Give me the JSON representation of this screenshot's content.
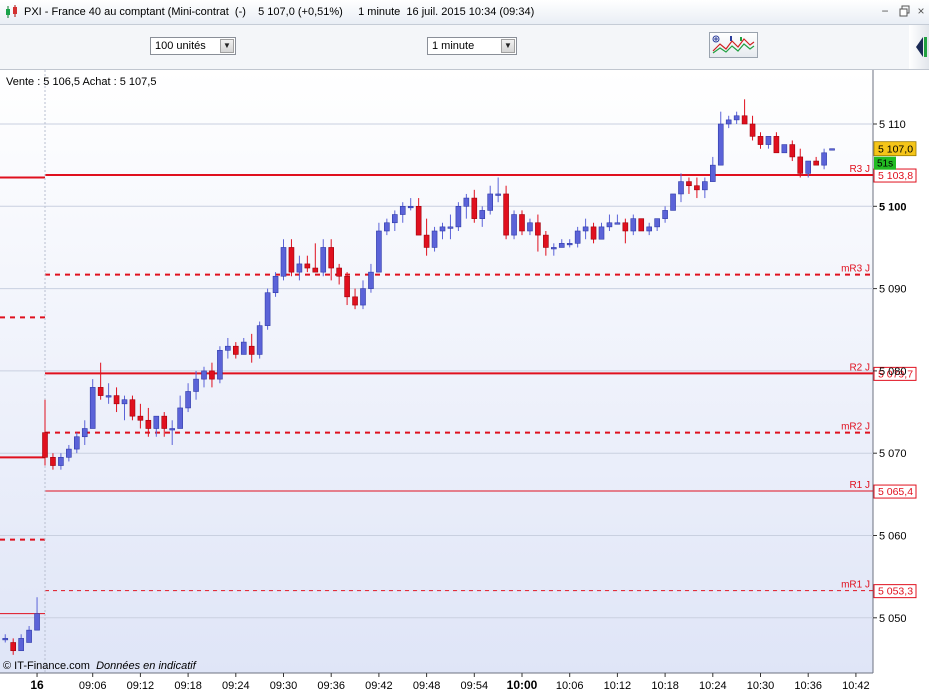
{
  "window": {
    "title": "PXI - France 40 au comptant (Mini-contrat  (-)    5 107,0 (+0,51%)     1 minute  16 juil. 2015 10:34 (09:34)",
    "minimize": "−",
    "close": "×"
  },
  "toolbar": {
    "quantity": "100 unités",
    "timeframe": "1 minute"
  },
  "quote": {
    "line": "Vente : 5 106,5 Achat : 5 107,5"
  },
  "footer": {
    "source": "© IT-Finance.com",
    "note": "Données en indicatif"
  },
  "colors": {
    "up": "#5b63d8",
    "down": "#e0101e",
    "pivot": "#e0101e",
    "price_badge": "#f5c518",
    "timer_badge": "#22bb22"
  },
  "chart_data": {
    "type": "candlestick",
    "ylim": [
      5041,
      5122
    ],
    "yticks": [
      {
        "v": 5050,
        "label": "5 050"
      },
      {
        "v": 5060,
        "label": "5 060"
      },
      {
        "v": 5070,
        "label": "5 070"
      },
      {
        "v": 5080,
        "label": "5 080"
      },
      {
        "v": 5090,
        "label": "5 090"
      },
      {
        "v": 5100,
        "label": "5 100"
      },
      {
        "v": 5110,
        "label": "5 110"
      }
    ],
    "xticks": [
      {
        "t": -1,
        "label": "16"
      },
      {
        "t": 6,
        "label": "09:06"
      },
      {
        "t": 12,
        "label": "09:12"
      },
      {
        "t": 18,
        "label": "09:18"
      },
      {
        "t": 24,
        "label": "09:24"
      },
      {
        "t": 30,
        "label": "09:30"
      },
      {
        "t": 36,
        "label": "09:36"
      },
      {
        "t": 42,
        "label": "09:42"
      },
      {
        "t": 48,
        "label": "09:48"
      },
      {
        "t": 54,
        "label": "09:54"
      },
      {
        "t": 60,
        "label": "10:00"
      },
      {
        "t": 66,
        "label": "10:06"
      },
      {
        "t": 72,
        "label": "10:12"
      },
      {
        "t": 78,
        "label": "10:18"
      },
      {
        "t": 84,
        "label": "10:24"
      },
      {
        "t": 90,
        "label": "10:30"
      },
      {
        "t": 96,
        "label": "10:36"
      },
      {
        "t": 102,
        "label": "10:42"
      }
    ],
    "prev_session_ohlc": [
      [
        5047.5,
        5048,
        5047,
        5047.5
      ],
      [
        5047,
        5047.5,
        5045.5,
        5046
      ],
      [
        5046,
        5048,
        5046,
        5047.5
      ],
      [
        5047,
        5049,
        5047,
        5048.5
      ],
      [
        5048.5,
        5052.5,
        5048.5,
        5050.5
      ]
    ],
    "ohlc": [
      [
        5072.5,
        5076.5,
        5068.5,
        5069.5
      ],
      [
        5069.5,
        5070,
        5068,
        5068.5
      ],
      [
        5068.5,
        5070,
        5068,
        5069.5
      ],
      [
        5069.5,
        5071,
        5069,
        5070.5
      ],
      [
        5070.5,
        5072.5,
        5070,
        5072
      ],
      [
        5072,
        5074,
        5071,
        5073
      ],
      [
        5073,
        5079,
        5073,
        5078
      ],
      [
        5078,
        5081,
        5076.5,
        5077
      ],
      [
        5077,
        5078.5,
        5076,
        5077
      ],
      [
        5077,
        5078,
        5075,
        5076
      ],
      [
        5076,
        5077,
        5074,
        5076.5
      ],
      [
        5076.5,
        5077,
        5074,
        5074.5
      ],
      [
        5074.5,
        5076,
        5073,
        5074
      ],
      [
        5074,
        5075.5,
        5072,
        5073
      ],
      [
        5073,
        5074.5,
        5072,
        5074.5
      ],
      [
        5074.5,
        5075,
        5072,
        5073
      ],
      [
        5073,
        5074,
        5071,
        5073
      ],
      [
        5073,
        5077,
        5073,
        5075.5
      ],
      [
        5075.5,
        5078.5,
        5075,
        5077.5
      ],
      [
        5077.5,
        5080,
        5076.5,
        5079
      ],
      [
        5079,
        5080.5,
        5078,
        5080
      ],
      [
        5080,
        5081,
        5078,
        5079
      ],
      [
        5079,
        5083,
        5078.5,
        5082.5
      ],
      [
        5082.5,
        5084,
        5081.5,
        5083
      ],
      [
        5083,
        5083.5,
        5081.5,
        5082
      ],
      [
        5082,
        5084,
        5082,
        5083.5
      ],
      [
        5083,
        5084.5,
        5081,
        5082
      ],
      [
        5082,
        5086,
        5081.5,
        5085.5
      ],
      [
        5085.5,
        5090,
        5085,
        5089.5
      ],
      [
        5089.5,
        5092,
        5089,
        5091.5
      ],
      [
        5091.5,
        5096,
        5091,
        5095
      ],
      [
        5095,
        5096,
        5091.5,
        5092
      ],
      [
        5092,
        5094,
        5091,
        5093
      ],
      [
        5093,
        5094,
        5092,
        5092.5
      ],
      [
        5092.5,
        5095.5,
        5092,
        5092
      ],
      [
        5092,
        5096,
        5091.5,
        5095
      ],
      [
        5095,
        5096,
        5091,
        5092.5
      ],
      [
        5092.5,
        5093,
        5090.5,
        5091.5
      ],
      [
        5091.5,
        5092,
        5088,
        5089
      ],
      [
        5089,
        5090,
        5087.5,
        5088
      ],
      [
        5088,
        5091,
        5087.5,
        5090
      ],
      [
        5090,
        5093,
        5089.5,
        5092
      ],
      [
        5092,
        5098,
        5092,
        5097
      ],
      [
        5097,
        5098.5,
        5096.5,
        5098
      ],
      [
        5098,
        5099.5,
        5097,
        5099
      ],
      [
        5099,
        5100.5,
        5098,
        5100
      ],
      [
        5100,
        5101,
        5099.5,
        5100
      ],
      [
        5100,
        5101,
        5097,
        5096.5
      ],
      [
        5096.5,
        5098.5,
        5094,
        5095
      ],
      [
        5095,
        5097.5,
        5094.5,
        5097
      ],
      [
        5097,
        5098,
        5096,
        5097.5
      ],
      [
        5097.5,
        5099,
        5096,
        5097.5
      ],
      [
        5097.5,
        5100.5,
        5097,
        5100
      ],
      [
        5100,
        5101.5,
        5098.5,
        5101
      ],
      [
        5101,
        5102,
        5098,
        5098.5
      ],
      [
        5098.5,
        5100,
        5097.5,
        5099.5
      ],
      [
        5099.5,
        5102.5,
        5099,
        5101.5
      ],
      [
        5101.5,
        5103.5,
        5100.5,
        5101.5
      ],
      [
        5101.5,
        5102.5,
        5096,
        5096.5
      ],
      [
        5096.5,
        5099.5,
        5096,
        5099
      ],
      [
        5099,
        5099.5,
        5096.5,
        5097
      ],
      [
        5097,
        5098.5,
        5096.5,
        5098
      ],
      [
        5098,
        5099,
        5094.5,
        5096.5
      ],
      [
        5096.5,
        5097,
        5094,
        5095
      ],
      [
        5095,
        5095.5,
        5094,
        5095
      ],
      [
        5095,
        5096,
        5095,
        5095.5
      ],
      [
        5095.5,
        5096,
        5095,
        5095.5
      ],
      [
        5095.5,
        5097.5,
        5095,
        5097
      ],
      [
        5097,
        5098.5,
        5096,
        5097.5
      ],
      [
        5097.5,
        5098,
        5095.5,
        5096
      ],
      [
        5096,
        5098,
        5096,
        5097.5
      ],
      [
        5097.5,
        5099,
        5097,
        5098
      ],
      [
        5098,
        5099,
        5098,
        5098
      ],
      [
        5098,
        5098.5,
        5095.5,
        5097
      ],
      [
        5097,
        5099,
        5096.5,
        5098.5
      ],
      [
        5098.5,
        5098.5,
        5097,
        5097
      ],
      [
        5097,
        5098,
        5096.5,
        5097.5
      ],
      [
        5097.5,
        5098.5,
        5097,
        5098.5
      ],
      [
        5098.5,
        5100,
        5098,
        5099.5
      ],
      [
        5099.5,
        5101.5,
        5099.5,
        5101.5
      ],
      [
        5101.5,
        5104,
        5100.5,
        5103
      ],
      [
        5103,
        5103.5,
        5101.5,
        5102.5
      ],
      [
        5102.5,
        5103.5,
        5101,
        5102
      ],
      [
        5102,
        5103.5,
        5101,
        5103
      ],
      [
        5103,
        5106,
        5103,
        5105
      ],
      [
        5105,
        5111.5,
        5105,
        5110
      ],
      [
        5110,
        5111,
        5109.5,
        5110.5
      ],
      [
        5110.5,
        5111.5,
        5110,
        5111
      ],
      [
        5111,
        5113,
        5110,
        5110
      ],
      [
        5110,
        5111,
        5108,
        5108.5
      ],
      [
        5108.5,
        5109,
        5107,
        5107.5
      ],
      [
        5107.5,
        5108.5,
        5107,
        5108.5
      ],
      [
        5108.5,
        5109,
        5106.5,
        5106.5
      ],
      [
        5106.5,
        5107.5,
        5106.5,
        5107.5
      ],
      [
        5107.5,
        5108,
        5105.5,
        5106
      ],
      [
        5106,
        5107,
        5103.5,
        5104
      ],
      [
        5104,
        5105.5,
        5103.5,
        5105.5
      ],
      [
        5105.5,
        5106,
        5105,
        5105
      ],
      [
        5105,
        5107,
        5104.5,
        5106.5
      ],
      [
        5107,
        5107,
        5107,
        5107
      ]
    ],
    "pivots": [
      {
        "name": "R3 J",
        "value": 5103.8,
        "label": "5 103,8",
        "style": "thick"
      },
      {
        "name": "mR3 J",
        "value": 5091.7,
        "label": "",
        "style": "dashed"
      },
      {
        "name": "R2 J",
        "value": 5079.7,
        "label": "5 079,7",
        "style": "thick"
      },
      {
        "name": "mR2 J",
        "value": 5072.5,
        "label": "",
        "style": "dashed"
      },
      {
        "name": "R1 J",
        "value": 5065.4,
        "label": "5 065,4",
        "style": "thin"
      },
      {
        "name": "mR1 J",
        "value": 5053.3,
        "label": "5 053,3",
        "style": "thin-dashed"
      }
    ],
    "prev_levels": [
      {
        "value": 5103.5,
        "style": "thick"
      },
      {
        "value": 5086.5,
        "style": "dashed"
      },
      {
        "value": 5069.5,
        "style": "thick"
      },
      {
        "value": 5059.5,
        "style": "dashed"
      },
      {
        "value": 5050.5,
        "style": "thin"
      }
    ],
    "last_price": {
      "value": 5107.0,
      "label": "5 107,0"
    },
    "timer": {
      "label": "51s"
    }
  }
}
